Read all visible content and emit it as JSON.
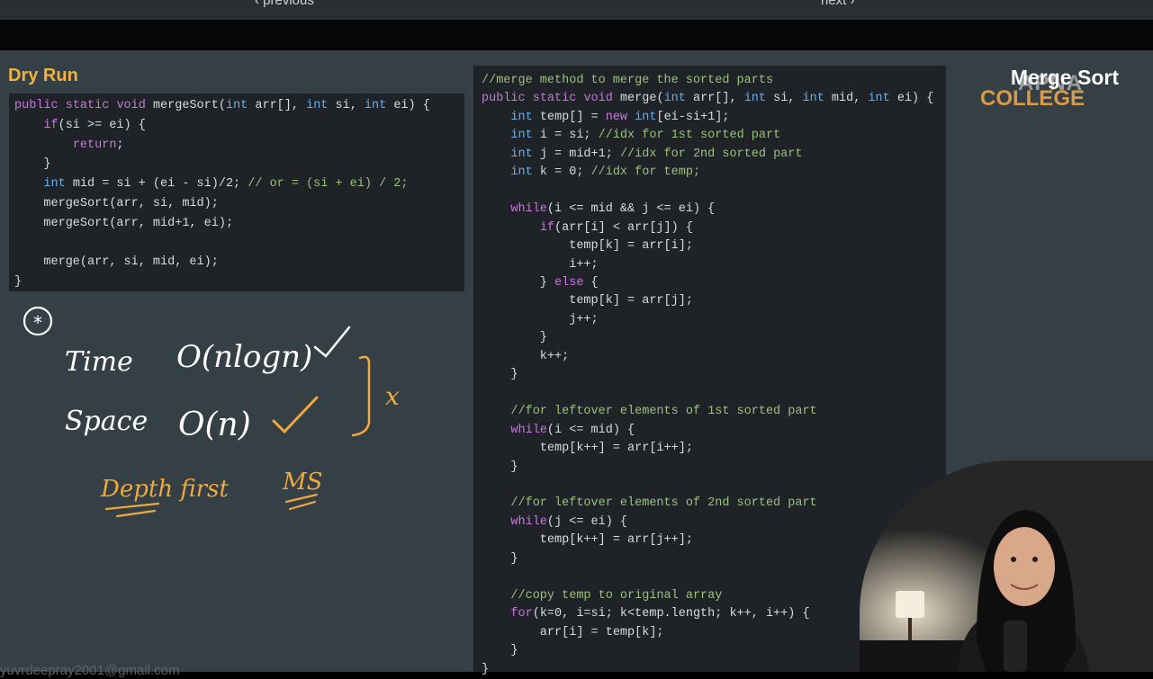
{
  "nav": {
    "previous": "‹ previous",
    "next": "next ›"
  },
  "slide_title": "Dry Run",
  "branding": {
    "title": "Merge Sort",
    "logo_top": "APNA",
    "logo_bottom": "COLLEGE"
  },
  "left_code": [
    "public static void mergeSort(int arr[], int si, int ei) {",
    "    if(si >= ei) {",
    "        return;",
    "    }",
    "    int mid = si + (ei - si)/2; // or = (si + ei) / 2;",
    "    mergeSort(arr, si, mid);",
    "    mergeSort(arr, mid+1, ei);",
    "",
    "    merge(arr, si, mid, ei);",
    "}"
  ],
  "right_code": [
    "//merge method to merge the sorted parts",
    "public static void merge(int arr[], int si, int mid, int ei) {",
    "    int temp[] = new int[ei-si+1];",
    "    int i = si; //idx for 1st sorted part",
    "    int j = mid+1; //idx for 2nd sorted part",
    "    int k = 0; //idx for temp;",
    "",
    "    while(i <= mid && j <= ei) {",
    "        if(arr[i] < arr[j]) {",
    "            temp[k] = arr[i];",
    "            i++;",
    "        } else {",
    "            temp[k] = arr[j];",
    "            j++;",
    "        }",
    "        k++;",
    "    }",
    "",
    "    //for leftover elements of 1st sorted part",
    "    while(i <= mid) {",
    "        temp[k++] = arr[i++];",
    "    }",
    "",
    "    //for leftover elements of 2nd sorted part",
    "    while(j <= ei) {",
    "        temp[k++] = arr[j++];",
    "    }",
    "",
    "    //copy temp to original array",
    "    for(k=0, i=si; k<temp.length; k++, i++) {",
    "        arr[i] = temp[k];",
    "    }",
    "}"
  ],
  "annotations": {
    "marker": "*",
    "time_label": "Time",
    "time_value": "O(nlogn)",
    "space_label": "Space",
    "space_value": "O(n)",
    "brace_mark": "x",
    "note_1": "Depth first",
    "note_2": "MS",
    "colors": {
      "white_ink": "#ffffff",
      "orange_ink": "#f0a93b"
    }
  },
  "email_partial": "yuvrdeepray2001@gmail.com"
}
